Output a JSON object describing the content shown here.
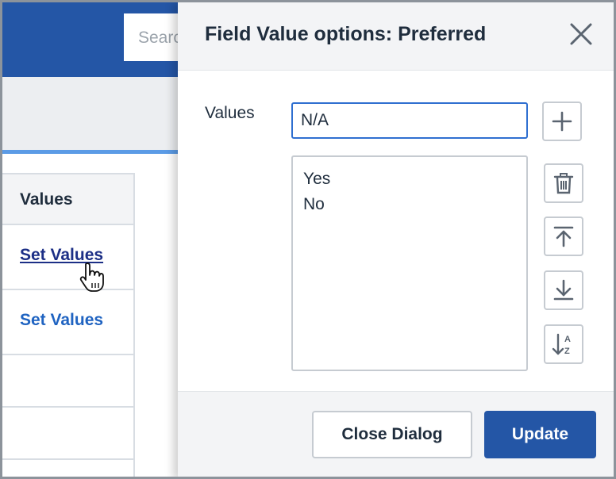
{
  "background": {
    "search_placeholder": "Search",
    "table": {
      "column_header": "Values",
      "rows": [
        "Set Values",
        "Set Values"
      ]
    }
  },
  "dialog": {
    "title": "Field Value options: Preferred",
    "values_label": "Values",
    "input_value": "N/A",
    "list_items": [
      "Yes",
      "No"
    ],
    "buttons": {
      "close_dialog": "Close Dialog",
      "update": "Update"
    },
    "icons": [
      "close-icon",
      "plus-icon",
      "trash-icon",
      "move-to-top-icon",
      "move-to-bottom-icon",
      "sort-az-icon"
    ]
  },
  "colors": {
    "brand_blue": "#2456a6",
    "link_blue": "#1f63c1",
    "link_active": "#1c2f86",
    "input_focus": "#2f6fd0"
  }
}
